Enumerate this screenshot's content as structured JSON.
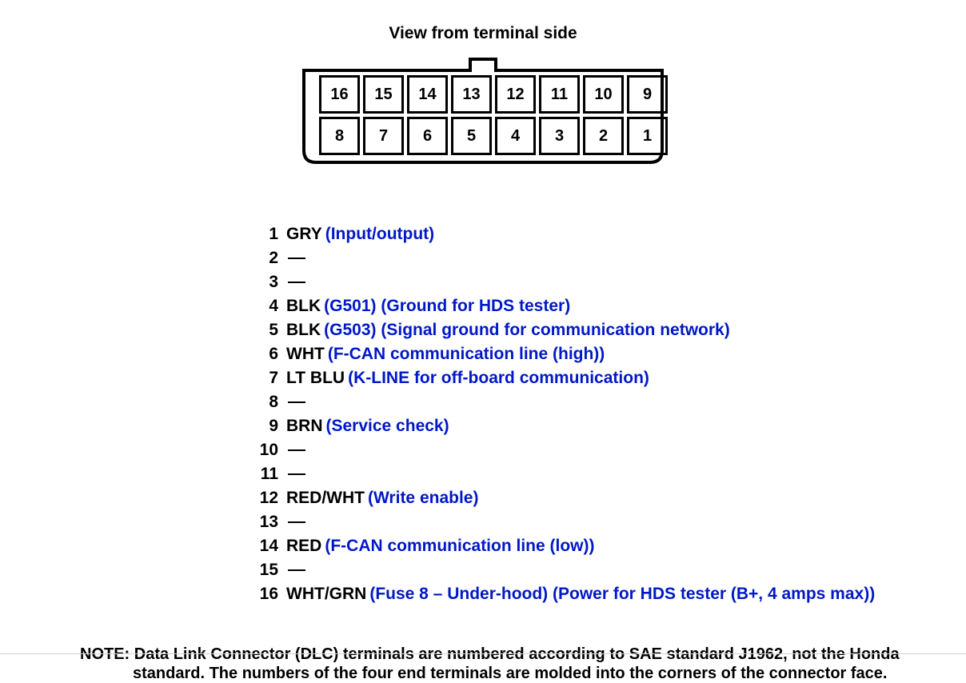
{
  "title": "View from terminal side",
  "pin_numbers_top": [
    "16",
    "15",
    "14",
    "13",
    "12",
    "11",
    "10",
    "9"
  ],
  "pin_numbers_bottom": [
    "8",
    "7",
    "6",
    "5",
    "4",
    "3",
    "2",
    "1"
  ],
  "pins": [
    {
      "no": "1",
      "color": "GRY",
      "desc": "(Input/output)"
    },
    {
      "no": "2",
      "color": "",
      "desc": ""
    },
    {
      "no": "3",
      "color": "",
      "desc": ""
    },
    {
      "no": "4",
      "color": "BLK",
      "desc": "(G501) (Ground for HDS tester)"
    },
    {
      "no": "5",
      "color": "BLK",
      "desc": "(G503) (Signal ground for communication network)"
    },
    {
      "no": "6",
      "color": "WHT",
      "desc": "(F-CAN communication line (high))"
    },
    {
      "no": "7",
      "color": "LT BLU",
      "desc": "(K-LINE for off-board communication)"
    },
    {
      "no": "8",
      "color": "",
      "desc": ""
    },
    {
      "no": "9",
      "color": "BRN",
      "desc": "(Service check)"
    },
    {
      "no": "10",
      "color": "",
      "desc": ""
    },
    {
      "no": "11",
      "color": "",
      "desc": ""
    },
    {
      "no": "12",
      "color": "RED/WHT",
      "desc": "(Write enable)"
    },
    {
      "no": "13",
      "color": "",
      "desc": ""
    },
    {
      "no": "14",
      "color": "RED",
      "desc": "(F-CAN communication line (low))"
    },
    {
      "no": "15",
      "color": "",
      "desc": ""
    },
    {
      "no": "16",
      "color": "WHT/GRN",
      "desc": "(Fuse 8 – Under-hood) (Power for HDS tester (B+, 4 amps max))"
    }
  ],
  "note_label": "NOTE:",
  "note_line1": "Data Link Connector (DLC) terminals are numbered according to SAE standard J1962, not the Honda",
  "note_line2": "standard. The numbers of the four end terminals are molded into the corners of the connector face."
}
